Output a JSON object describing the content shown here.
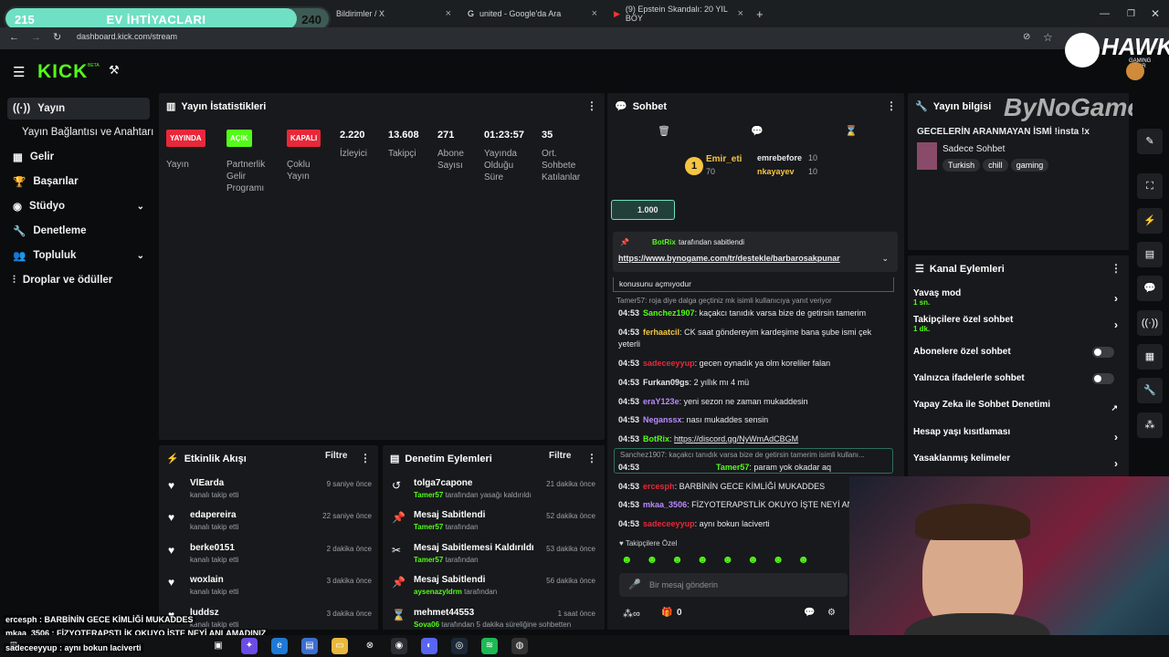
{
  "goal": {
    "left": "215",
    "title": "EV İHTİYACLARI",
    "right": "240",
    "progress": 0.9
  },
  "browser": {
    "tabs": [
      "Bildirimler / X",
      "united - Google'da Ara",
      "(9) Epstein Skandalı: 20 YIL BÖY"
    ],
    "url": "dashboard.kick.com/stream"
  },
  "brand": {
    "logo": "KICK",
    "beta": "BETA",
    "hawk": "HAWK",
    "hawk_sub": "GAMING CHAIR",
    "bynogame": "ByNoGame"
  },
  "sidebar": {
    "items": [
      "Yayın",
      "Yayın Bağlantısı ve Anahtarı",
      "Gelir",
      "Başarılar",
      "Stüdyo",
      "Denetleme",
      "Topluluk",
      "Droplar ve ödüller"
    ]
  },
  "stats": {
    "title": "Yayın İstatistikleri",
    "badges": [
      {
        "label": "YAYINDA",
        "caption": "Yayın",
        "color": "#e8283a"
      },
      {
        "label": "AÇIK",
        "caption": "Partnerlik Gelir Programı",
        "color": "#53fc18"
      },
      {
        "label": "KAPALI",
        "caption": "Çoklu Yayın",
        "color": "#e8283a"
      }
    ],
    "values": [
      {
        "value": "2.220",
        "label": "İzleyici"
      },
      {
        "value": "13.608",
        "label": "Takipçi"
      },
      {
        "value": "271",
        "label": "Abone Sayısı"
      },
      {
        "value": "01:23:57",
        "label": "Yayında Olduğu Süre"
      },
      {
        "value": "35",
        "label": "Ort. Sohbete Katılanlar"
      }
    ]
  },
  "events": {
    "title": "Etkinlik Akışı",
    "filter": "Filtre",
    "items": [
      {
        "name": "VlEarda",
        "sub": "kanalı takip etti",
        "time": "9 saniye önce"
      },
      {
        "name": "edapereira",
        "sub": "kanalı takip etti",
        "time": "22 saniye önce"
      },
      {
        "name": "berke0151",
        "sub": "kanalı takip etti",
        "time": "2 dakika önce"
      },
      {
        "name": "woxlain",
        "sub": "kanalı takip etti",
        "time": "3 dakika önce"
      },
      {
        "name": "luddsz",
        "sub": "kanalı takip etti",
        "time": "3 dakika önce"
      }
    ]
  },
  "modlog": {
    "title": "Denetim Eylemleri",
    "filter": "Filtre",
    "items": [
      {
        "title": "tolga7capone",
        "by": "Tamer57",
        "sub": "tarafından yasağı kaldırıldı",
        "time": "21 dakika önce",
        "icon": "↺"
      },
      {
        "title": "Mesaj Sabitlendi",
        "by": "Tamer57",
        "sub": "tarafından",
        "time": "52 dakika önce",
        "icon": "📌"
      },
      {
        "title": "Mesaj Sabitlemesi Kaldırıldı",
        "by": "Tamer57",
        "sub": "tarafından",
        "time": "53 dakika önce",
        "icon": "✂"
      },
      {
        "title": "Mesaj Sabitlendi",
        "by": "aysenazyldrm",
        "sub": "tarafından",
        "time": "56 dakika önce",
        "icon": "📌"
      },
      {
        "title": "mehmet44553",
        "by": "Sova06",
        "sub": "tarafından 5 dakika süreliğine sohbetten",
        "time": "1 saat önce",
        "icon": "⌛"
      }
    ]
  },
  "chat": {
    "title": "Sohbet",
    "leader": {
      "rank": "1",
      "name": "Emir_eti",
      "count": "70",
      "others": [
        {
          "name": "emrebefore",
          "count": "10"
        },
        {
          "name": "nkayayev",
          "count": "10"
        }
      ]
    },
    "bits": "1.000",
    "pinned": {
      "by": "BotRix",
      "suffix": "tarafından sabitlendi",
      "link": "https://www.bynogame.com/tr/destekle/barbarosakpunar",
      "extra": "konusunu açmıyodur"
    },
    "reply1": "Tamer57: roja diye dalga geçtiniz mk isimli kullanıcıya yanıt veriyor",
    "messages": [
      {
        "time": "04:53",
        "user": "Sanchez1907",
        "color": "#53fc18",
        "text": "kaçakcı tanıdık varsa bize de getirsin tamerim"
      },
      {
        "time": "04:53",
        "user": "ferhaatcil",
        "color": "#f5c542",
        "text": "CK saat göndereyim kardeşime bana şube ismi çek yeterli"
      },
      {
        "time": "04:53",
        "user": "sadeceeyyup",
        "color": "#e8283a",
        "text": "gecen oynadık ya olm koreliler falan"
      },
      {
        "time": "04:53",
        "user": "Furkan09gs",
        "color": "#e9eaec",
        "text": "2 yıllık mı 4 mü"
      },
      {
        "time": "04:53",
        "user": "eraY123e",
        "color": "#b98bff",
        "text": "yeni sezon ne zaman mukaddesin"
      },
      {
        "time": "04:53",
        "user": "Neganssx",
        "color": "#b98bff",
        "text": "nası mukaddes sensin"
      },
      {
        "time": "04:53",
        "user": "BotRix",
        "color": "#53fc18",
        "text": "https://discord.gg/NyWmAdCBGM"
      }
    ],
    "reply2": "Sanchez1907: kaçakcı tanıdık varsa bize de getirsin tamerim isimli kullanı...",
    "messages2": [
      {
        "time": "04:53",
        "user": "Tamer57",
        "color": "#53fc18",
        "text": "param yok okadar aq"
      },
      {
        "time": "04:53",
        "user": "ercesph",
        "color": "#e8283a",
        "text": "BARBİNİN GECE KİMLİĞİ MUKADDES"
      },
      {
        "time": "04:53",
        "user": "mkaa_3506",
        "color": "#b98bff",
        "text": "FİZYOTERAPSTLİK OKUYO İŞTE NEYİ ANL"
      },
      {
        "time": "04:53",
        "user": "sadeceeyyup",
        "color": "#e8283a",
        "text": "aynı bokun laciverti"
      }
    ],
    "followers_only": "Takipçilere Özel",
    "placeholder": "Bir mesaj gönderin",
    "count": "0"
  },
  "info": {
    "title": "Yayın bilgisi",
    "stream_title": "GECELERİN ARANMAYAN İSMİ !insta !x",
    "category": "Sadece Sohbet",
    "tags": [
      "Turkish",
      "chill",
      "gaming"
    ]
  },
  "channel": {
    "title": "Kanal Eylemleri",
    "items": [
      {
        "label": "Yavaş mod",
        "sub": "1 sn.",
        "type": "arrow"
      },
      {
        "label": "Takipçilere özel sohbet",
        "sub": "1 dk.",
        "type": "arrow"
      },
      {
        "label": "Abonelere özel sohbet",
        "sub": "",
        "type": "toggle"
      },
      {
        "label": "Yalnızca ifadelerle sohbet",
        "sub": "",
        "type": "toggle"
      },
      {
        "label": "Yapay Zeka ile Sohbet Denetimi",
        "sub": "",
        "type": "ext"
      },
      {
        "label": "Hesap yaşı kısıtlaması",
        "sub": "",
        "type": "arrow"
      },
      {
        "label": "Yasaklanmış kelimeler",
        "sub": "",
        "type": "arrow"
      }
    ]
  },
  "overlay": [
    "ercesph : BARBİNİN GECE KİMLİĞİ MUKADDES",
    "mkaa_3506 : FİZYOTERAPSTLİK OKUYO İŞTE NEYİ ANLAMADINIZ",
    "sadeceeyyup : aynı bokun laciverti"
  ]
}
